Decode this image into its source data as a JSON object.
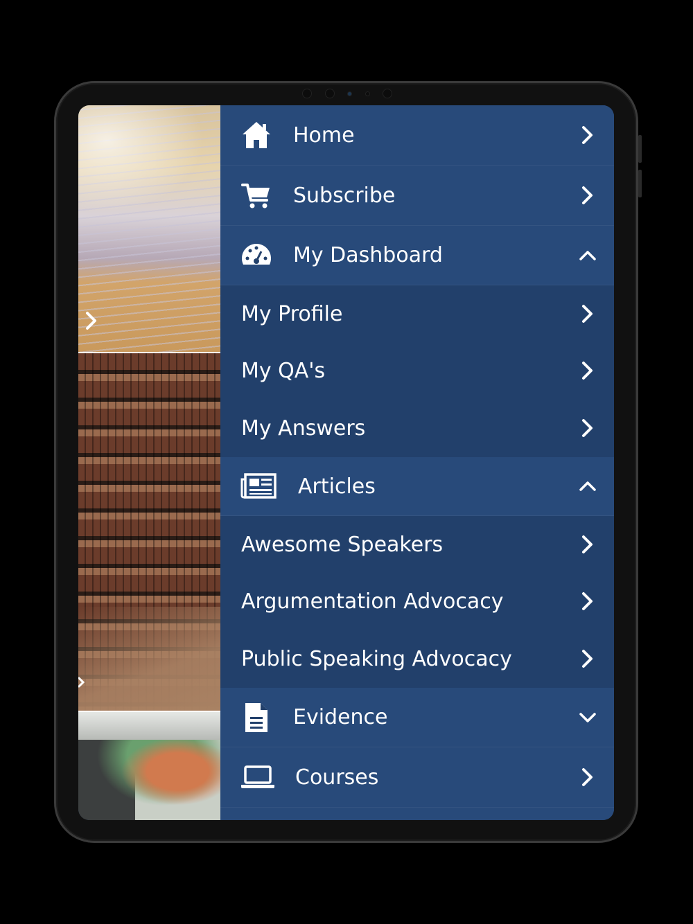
{
  "menu": {
    "home": "Home",
    "subscribe": "Subscribe",
    "dashboard": "My Dashboard",
    "dashboard_items": [
      "My Profile",
      "My QA's",
      "My Answers"
    ],
    "articles": "Articles",
    "article_items": [
      "Awesome Speakers",
      "Argumentation Advocacy",
      "Public Speaking Advocacy"
    ],
    "evidence": "Evidence",
    "courses": "Courses"
  },
  "icons": {
    "home": "home-icon",
    "subscribe": "cart-icon",
    "dashboard": "dashboard-gauge-icon",
    "articles": "newspaper-icon",
    "evidence": "document-icon",
    "courses": "laptop-icon"
  },
  "colors": {
    "menu_bg": "#22406b",
    "menu_header_bg": "#284a7a",
    "text": "#ffffff"
  }
}
